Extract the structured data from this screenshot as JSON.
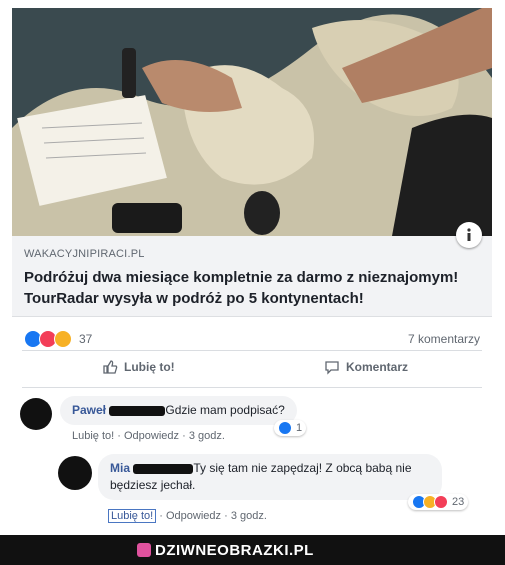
{
  "post": {
    "domain": "WAKACYJNIPIRACI.PL",
    "title": "Podróżuj dwa miesiące kompletnie za darmo z nieznajomym! TourRadar wysyła w podróż po 5 kontynentach!",
    "reaction_count": "37",
    "comments_count": "7 komentarzy",
    "like_label": "Lubię to!",
    "comment_label": "Komentarz"
  },
  "comments": [
    {
      "author": "Paweł",
      "text": "Gdzie mam podpisać?",
      "like_label": "Lubię to!",
      "reply_label": "Odpowiedz",
      "time": "3 godz.",
      "reactions": "1"
    },
    {
      "author": "Mia",
      "text": "Ty się tam nie zapędzaj! Z obcą babą nie będziesz jechał.",
      "like_label": "Lubię to!",
      "reply_label": "Odpowiedz",
      "time": "3 godz.",
      "reactions": "23"
    }
  ],
  "footer": {
    "brand": "DZIWNEOBRAZKI.PL"
  }
}
